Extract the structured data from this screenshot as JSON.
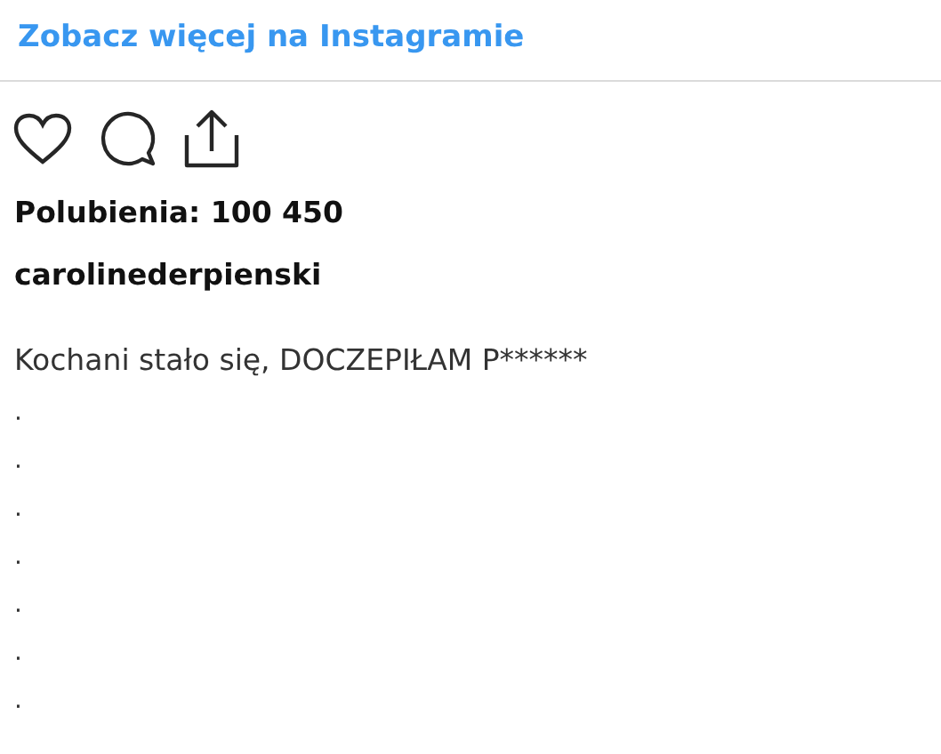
{
  "link": "Zobacz więcej na Instagramie",
  "likes": "Polubienia: 100 450",
  "username": "carolinederpienski",
  "caption": "Kochani stało się, DOCZEPIŁAM P******",
  "caption_lines": [
    ".",
    ".",
    ".",
    ".",
    ".",
    ".",
    "."
  ]
}
